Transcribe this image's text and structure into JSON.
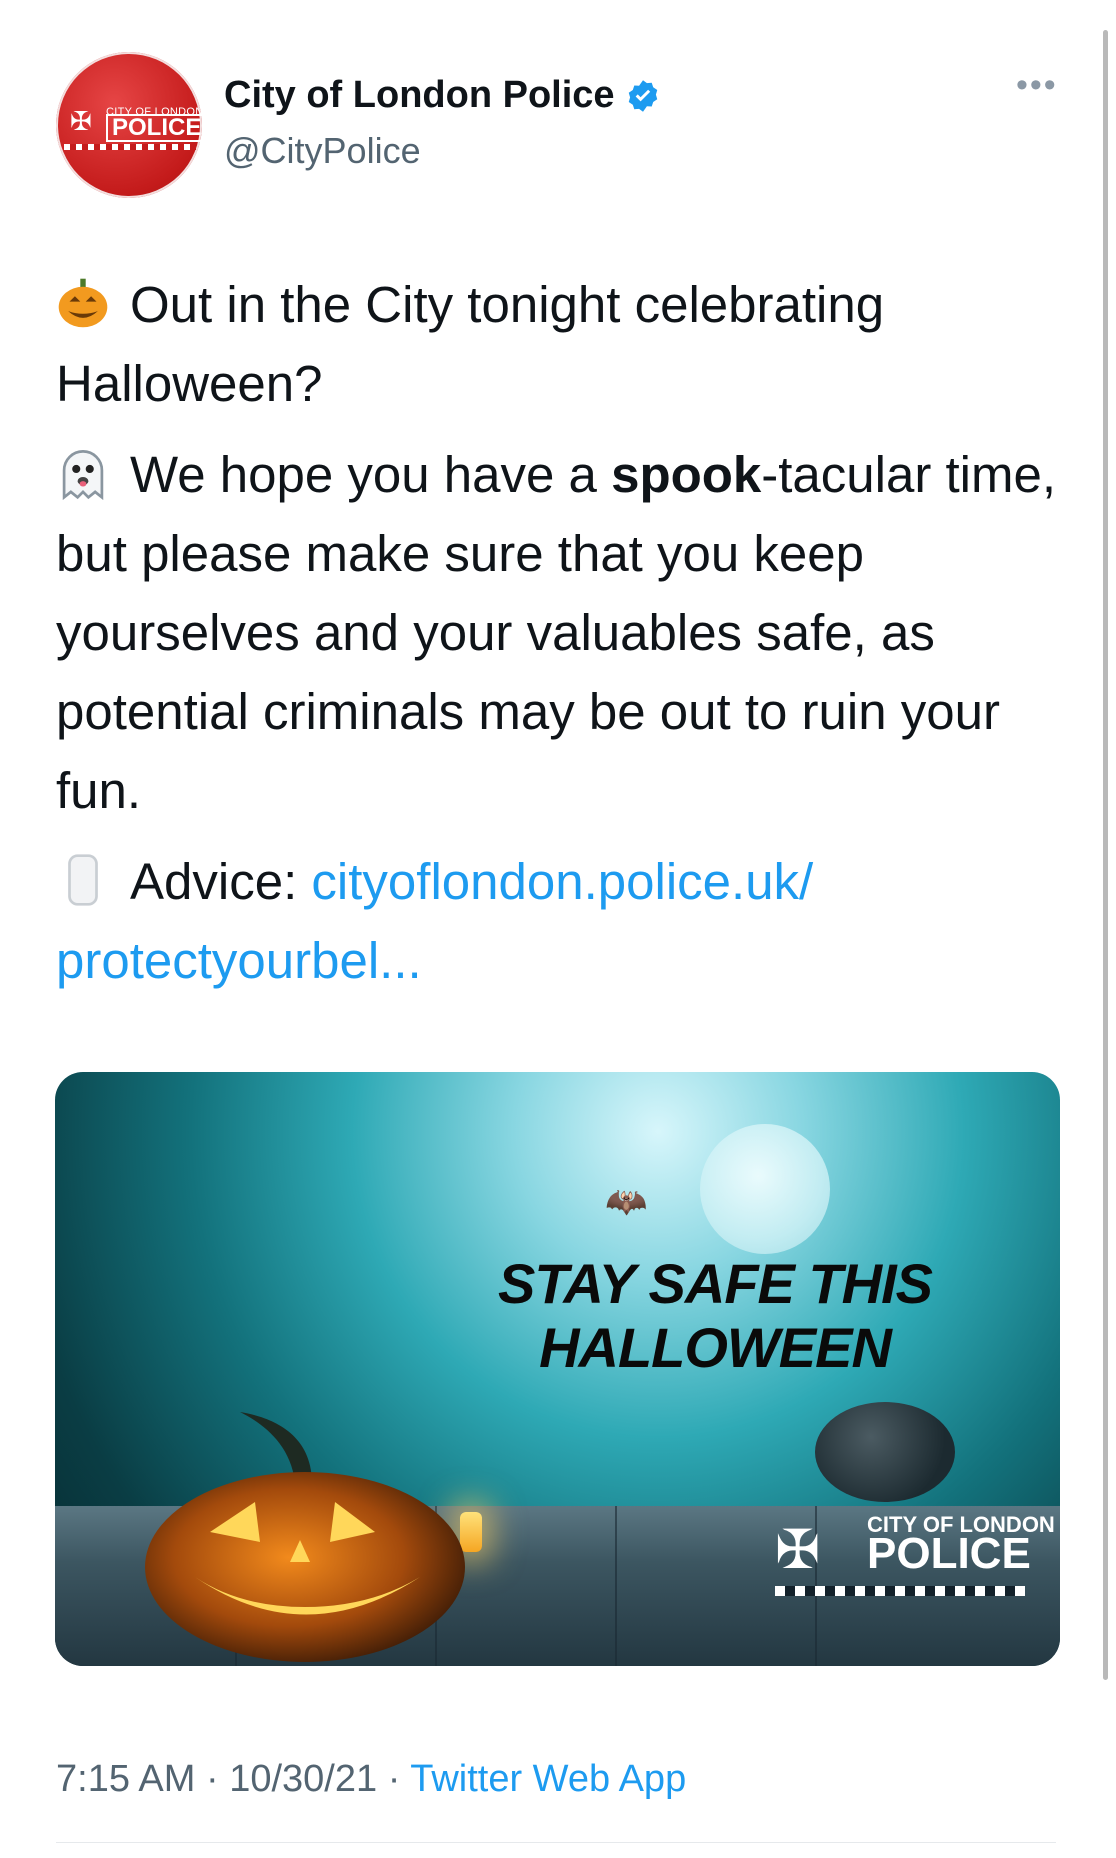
{
  "tweet": {
    "author": {
      "name": "City of London Police",
      "handle": "@CityPolice",
      "avatar_text_top": "CITY OF LONDON",
      "avatar_text_main": "POLICE"
    },
    "more_label": "•••",
    "paragraphs": [
      {
        "emoji": "jack-o-lantern",
        "text": "Out in the City tonight celebrating Halloween?"
      },
      {
        "emoji": "ghost",
        "text_before": "We hope you have a ",
        "bold": "spook",
        "text_after": "-tacular time, but please make sure that you keep yourselves and your valuables safe, as potential criminals may be out to ruin your fun."
      },
      {
        "emoji": "mobile-phone",
        "prefix": "Advice: ",
        "link": "cityoflondon.police.uk/ protectyourbel..."
      }
    ],
    "media": {
      "headline_line1": "STAY SAFE THIS",
      "headline_line2": "HALLOWEEN",
      "logo_city": "CITY OF LONDON",
      "logo_police": "POLICE"
    },
    "meta": {
      "time": "7:15 AM",
      "date": "10/30/21",
      "separator": "·",
      "source": "Twitter Web App"
    }
  },
  "colors": {
    "link": "#1d9bf0",
    "secondary_text": "#536471",
    "avatar_red": "#c41b1b"
  }
}
